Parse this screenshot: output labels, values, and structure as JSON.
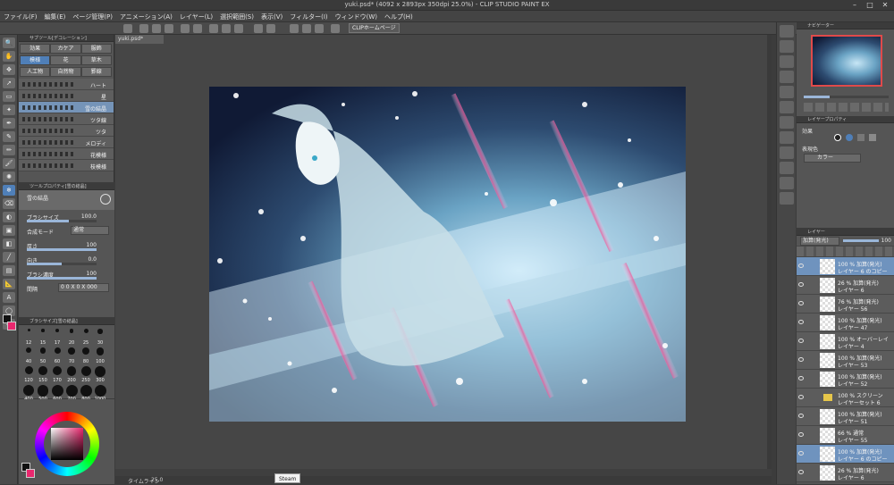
{
  "title": "yuki.psd* (4092 x 2893px 350dpi 25.0%)  - CLIP STUDIO PAINT EX",
  "menu": [
    "ファイル(F)",
    "編集(E)",
    "ページ管理(P)",
    "アニメーション(A)",
    "レイヤー(L)",
    "選択範囲(S)",
    "表示(V)",
    "フィルター(I)",
    "ウィンドウ(W)",
    "ヘルプ(H)"
  ],
  "command_bar": {
    "homepage_label": "CLIPホームページ"
  },
  "document_tab": "yuki.psd*",
  "subtool": {
    "header": "サブツール[デコレーション]",
    "tabs": [
      {
        "label": "効果",
        "selected": false
      },
      {
        "label": "カケア",
        "selected": false
      },
      {
        "label": "服飾",
        "selected": false
      },
      {
        "label": "模様",
        "selected": true
      },
      {
        "label": "花",
        "selected": false
      },
      {
        "label": "草木",
        "selected": false
      },
      {
        "label": "人工物",
        "selected": false
      },
      {
        "label": "自然物",
        "selected": false
      },
      {
        "label": "罫線",
        "selected": false
      }
    ],
    "brushes": [
      {
        "label": "ハート",
        "selected": false
      },
      {
        "label": "星",
        "selected": false
      },
      {
        "label": "雪の結晶",
        "selected": true
      },
      {
        "label": "ツタ線",
        "selected": false
      },
      {
        "label": "ツタ",
        "selected": false
      },
      {
        "label": "メロディ",
        "selected": false
      },
      {
        "label": "花模様",
        "selected": false
      },
      {
        "label": "枝模様",
        "selected": false
      }
    ]
  },
  "tool_property": {
    "header": "ツールプロパティ[雪の結晶]",
    "preset": "雪の結晶",
    "brush_size": {
      "label": "ブラシサイズ",
      "value": "100.0"
    },
    "blend_mode": {
      "label": "合成モード",
      "value": "通常"
    },
    "thickness": {
      "label": "厚さ",
      "value": "100"
    },
    "direction": {
      "label": "向き",
      "value": "0.0"
    },
    "brush_density": {
      "label": "ブラシ濃度",
      "value": "100"
    },
    "spacing": {
      "label": "間隔",
      "value": "0 0 X 0 X 000"
    }
  },
  "brush_size_panel": {
    "header": "ブラシサイズ[雪の結晶]",
    "sizes": [
      "12",
      "15",
      "17",
      "20",
      "25",
      "30",
      "40",
      "50",
      "60",
      "70",
      "80",
      "100",
      "120",
      "150",
      "170",
      "200",
      "250",
      "300",
      "400",
      "500",
      "600",
      "700",
      "800",
      "1000"
    ]
  },
  "status": {
    "zoom": "25.0",
    "timeline": "タイムライン"
  },
  "tooltip": "Steam",
  "navigator": {
    "header": "ナビゲーター"
  },
  "layer_property": {
    "header": "レイヤープロパティ",
    "effect": "効果",
    "expression_label": "表現色",
    "expression_value": "カラー"
  },
  "layer_panel": {
    "header": "レイヤー",
    "blend_mode": "加算(発光)",
    "opacity": "100",
    "layers": [
      {
        "line1": "100 % 加算(発光)",
        "line2": "レイヤー 6 のコピー",
        "selected": true,
        "folder": false
      },
      {
        "line1": "26 % 加算(発光)",
        "line2": "レイヤー 6",
        "selected": false,
        "folder": false
      },
      {
        "line1": "76 % 加算(発光)",
        "line2": "レイヤー 56",
        "selected": false,
        "folder": false
      },
      {
        "line1": "100 % 加算(発光)",
        "line2": "レイヤー 47",
        "selected": false,
        "folder": false
      },
      {
        "line1": "100 % オーバーレイ",
        "line2": "レイヤー 4",
        "selected": false,
        "folder": false
      },
      {
        "line1": "100 % 加算(発光)",
        "line2": "レイヤー 53",
        "selected": false,
        "folder": false
      },
      {
        "line1": "100 % 加算(発光)",
        "line2": "レイヤー 52",
        "selected": false,
        "folder": false
      },
      {
        "line1": "100 % スクリーン",
        "line2": "レイヤーセット 6",
        "selected": false,
        "folder": true
      },
      {
        "line1": "100 % 加算(発光)",
        "line2": "レイヤー 51",
        "selected": false,
        "folder": false
      },
      {
        "line1": "66 % 通常",
        "line2": "レイヤー 55",
        "selected": false,
        "folder": false
      },
      {
        "line1": "100 % 加算(発光)",
        "line2": "レイヤー 6 のコピー",
        "selected": true,
        "folder": false
      },
      {
        "line1": "26 % 加算(発光)",
        "line2": "レイヤー 6",
        "selected": false,
        "folder": false
      }
    ]
  },
  "colors": {
    "main": "#111111",
    "sub": "#e9276e",
    "accent": "#4f7fb8"
  }
}
